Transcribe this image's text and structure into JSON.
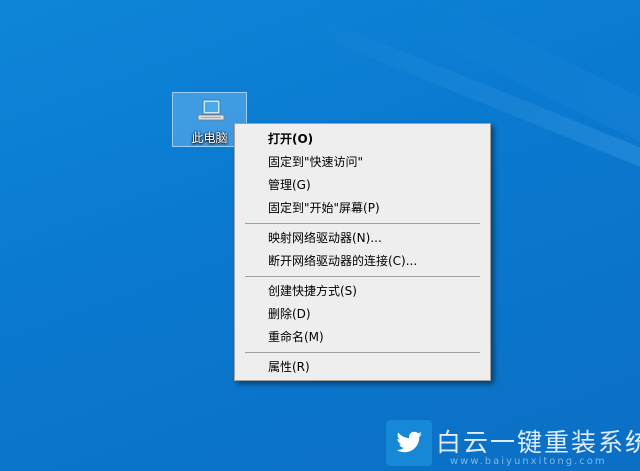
{
  "desktop": {
    "background_color": "#0b7fd4",
    "icon": {
      "label": "此电脑",
      "icon_name": "computer-icon"
    }
  },
  "context_menu": {
    "groups": [
      [
        {
          "label": "打开(O)",
          "bold": true
        },
        {
          "label": "固定到\"快速访问\""
        },
        {
          "label": "管理(G)"
        },
        {
          "label": "固定到\"开始\"屏幕(P)"
        }
      ],
      [
        {
          "label": "映射网络驱动器(N)..."
        },
        {
          "label": "断开网络驱动器的连接(C)..."
        }
      ],
      [
        {
          "label": "创建快捷方式(S)"
        },
        {
          "label": "删除(D)"
        },
        {
          "label": "重命名(M)"
        }
      ],
      [
        {
          "label": "属性(R)"
        }
      ]
    ]
  },
  "watermark": {
    "brand": "白云一键重装系统",
    "url": "www.baiyunxitong.com",
    "icon_name": "twitter-bird-icon"
  }
}
